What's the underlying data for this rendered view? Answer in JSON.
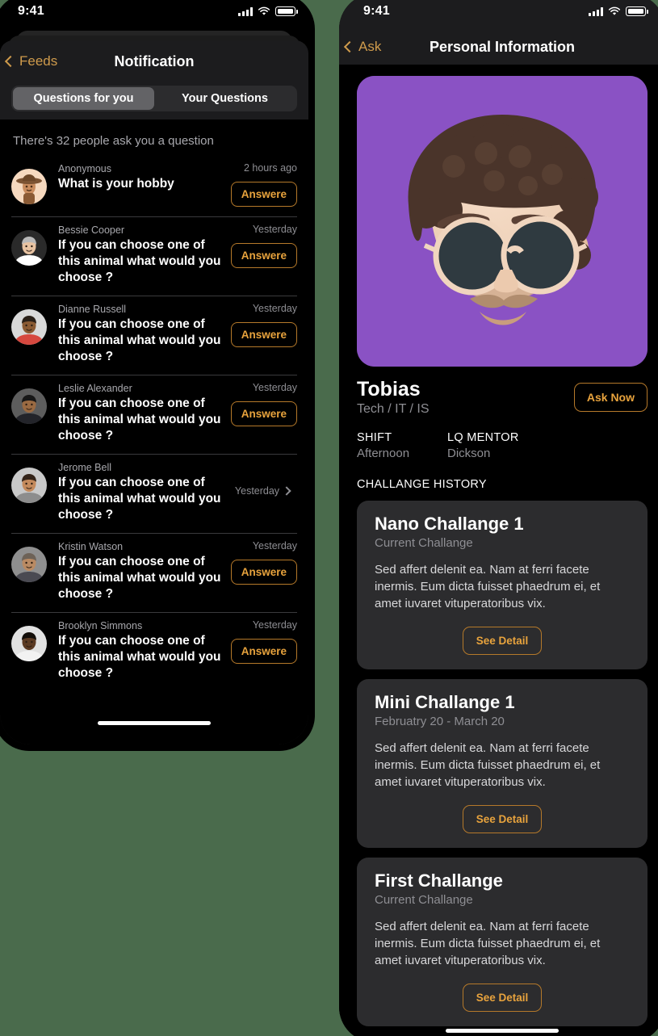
{
  "background_color": "#4a6b4c",
  "accent_color": "#e8a33d",
  "accent_border_color": "#b5792a",
  "left_phone": {
    "status_bar": {
      "time": "9:41",
      "icons": [
        "cellular-signal-icon",
        "wifi-icon",
        "battery-icon"
      ]
    },
    "nav": {
      "back_label": "Feeds",
      "title": "Notification"
    },
    "segmented": {
      "options": [
        "Questions for you",
        "Your Questions"
      ],
      "selected_index": 0
    },
    "list_header": "There's 32 people ask you a question",
    "questions": [
      {
        "name": "Anonymous",
        "text": "What is your hobby",
        "time": "2 hours ago",
        "action": "Answere",
        "has_chevron": false,
        "avatar": "memoji-hat-avatar"
      },
      {
        "name": "Bessie Cooper",
        "text": "If you can choose one of this animal what would you choose ?",
        "time": "Yesterday",
        "action": "Answere",
        "has_chevron": false,
        "avatar": "photo-avatar-bessie"
      },
      {
        "name": "Dianne Russell",
        "text": "If you can choose one of this animal what would you choose ?",
        "time": "Yesterday",
        "action": "Answere",
        "has_chevron": false,
        "avatar": "photo-avatar-dianne"
      },
      {
        "name": "Leslie Alexander",
        "text": "If you can choose one of this animal what would you choose ?",
        "time": "Yesterday",
        "action": "Answere",
        "has_chevron": false,
        "avatar": "photo-avatar-leslie"
      },
      {
        "name": "Jerome Bell",
        "text": "If you can choose one of this animal what would you choose ?",
        "time": "Yesterday",
        "action": "",
        "has_chevron": true,
        "avatar": "photo-avatar-jerome"
      },
      {
        "name": "Kristin Watson",
        "text": "If you can choose one of this animal what would you choose ?",
        "time": "Yesterday",
        "action": "Answere",
        "has_chevron": false,
        "avatar": "photo-avatar-kristin"
      },
      {
        "name": "Brooklyn Simmons",
        "text": "If you can choose one of this animal what would you choose ?",
        "time": "Yesterday",
        "action": "Answere",
        "has_chevron": false,
        "avatar": "photo-avatar-brooklyn"
      }
    ]
  },
  "right_phone": {
    "status_bar": {
      "time": "9:41",
      "icons": [
        "cellular-signal-icon",
        "wifi-icon",
        "battery-icon"
      ]
    },
    "nav": {
      "back_label": "Ask",
      "title": "Personal Information"
    },
    "hero": {
      "avatar": "memoji-sunglasses-avatar",
      "background_color": "#8a52c4"
    },
    "profile": {
      "name": "Tobias",
      "role": "Tech / IT / IS",
      "ask_button": "Ask Now"
    },
    "meta": [
      {
        "key": "SHIFT",
        "value": "Afternoon"
      },
      {
        "key": "LQ MENTOR",
        "value": "Dickson"
      }
    ],
    "section_title": "CHALLANGE HISTORY",
    "challenges": [
      {
        "title": "Nano Challange 1",
        "subtitle": "Current Challange",
        "body": "Sed affert delenit ea. Nam at ferri facete inermis. Eum dicta fuisset phaedrum ei, et amet iuvaret vituperatoribus vix.",
        "button": "See Detail"
      },
      {
        "title": "Mini Challange 1",
        "subtitle": "Februatry 20 - March 20",
        "body": "Sed affert delenit ea. Nam at ferri facete inermis. Eum dicta fuisset phaedrum ei, et amet iuvaret vituperatoribus vix.",
        "button": "See Detail"
      },
      {
        "title": "First Challange",
        "subtitle": "Current Challange",
        "body": "Sed affert delenit ea. Nam at ferri facete inermis. Eum dicta fuisset phaedrum ei, et amet iuvaret vituperatoribus vix.",
        "button": "See Detail"
      }
    ]
  }
}
